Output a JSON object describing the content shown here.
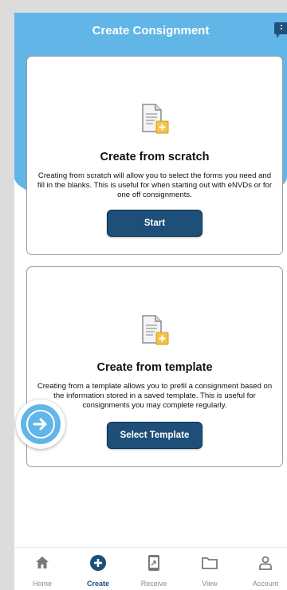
{
  "header": {
    "title": "Create Consignment"
  },
  "cards": [
    {
      "title": "Create from scratch",
      "description": "Creating from scratch will allow you to select the forms you need and fill in the blanks. This is useful for when starting out with eNVDs or for one off consignments.",
      "button_label": "Start"
    },
    {
      "title": "Create from template",
      "description": "Creating from a template allows you to prefil a consignment based on the information stored in a saved template. This is useful for consignments you may complete regularly.",
      "button_label": "Select Template"
    }
  ],
  "nav": {
    "items": [
      {
        "label": "Home",
        "icon": "home-icon"
      },
      {
        "label": "Create",
        "icon": "plus-circle-icon",
        "active": true
      },
      {
        "label": "Receive",
        "icon": "receive-tablet-icon"
      },
      {
        "label": "View",
        "icon": "folder-icon"
      },
      {
        "label": "Account",
        "icon": "user-icon"
      }
    ]
  },
  "colors": {
    "header_blue": "#62b6e7",
    "button_navy": "#1d4f78",
    "icon_gray": "#7a7a7a",
    "active_nav": "#1d4f78"
  }
}
